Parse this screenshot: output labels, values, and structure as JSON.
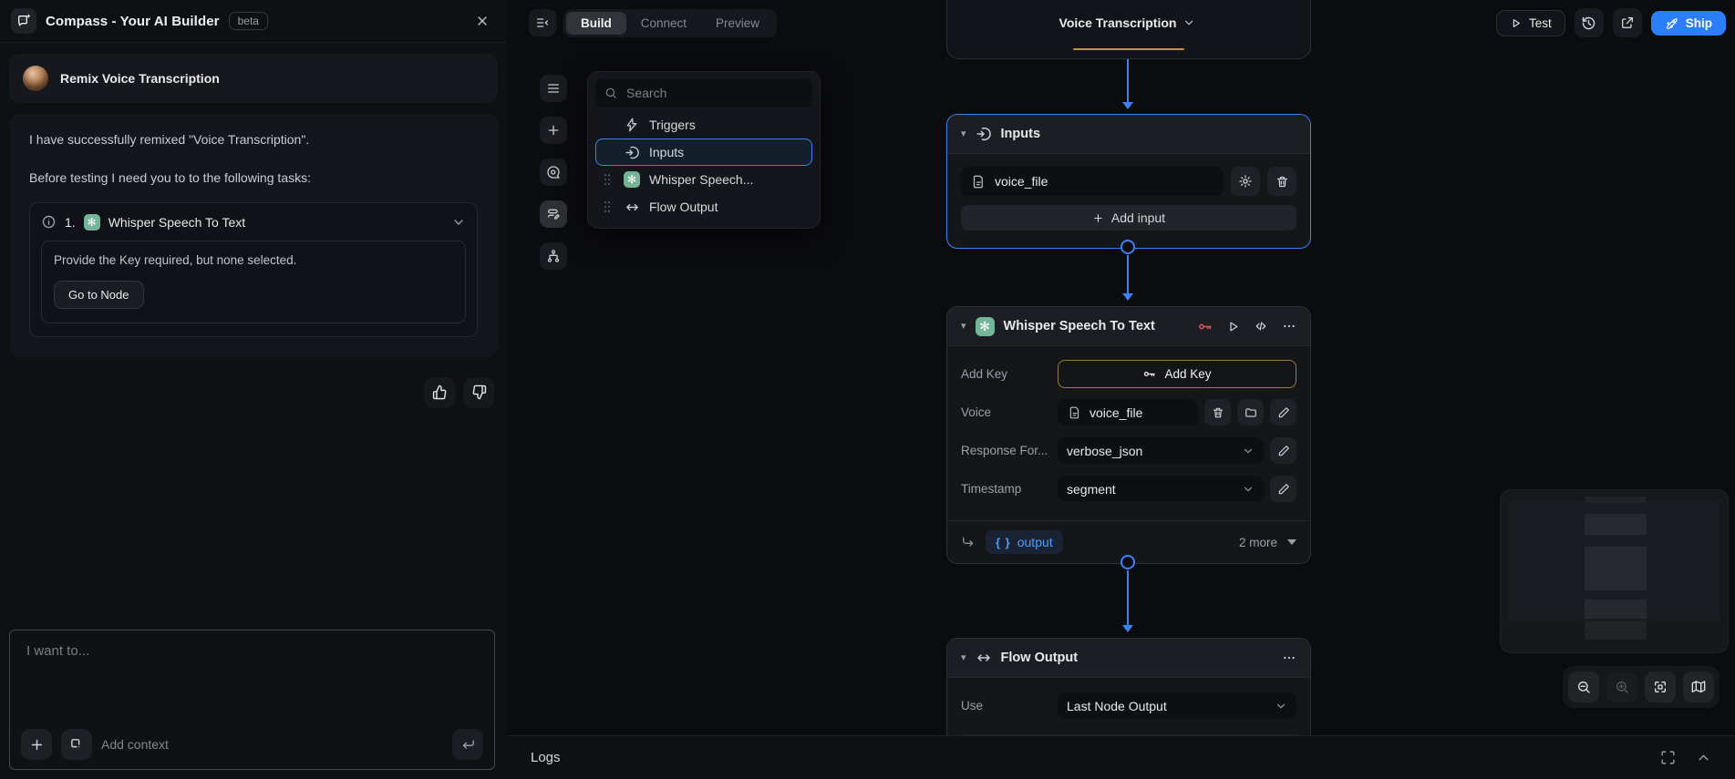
{
  "colors": {
    "accent_blue": "#3b82f6",
    "ship_blue": "#2b7fff",
    "openai_teal": "#74b598",
    "key_red": "#e5565f",
    "warn_gold": "#c29245"
  },
  "icons": {
    "caret_down": "▾",
    "openai_glyph": "✻",
    "braces": "{ }",
    "gear": "⚙"
  },
  "titlebar": {
    "app_title": "Compass - Your AI Builder",
    "beta_badge": "beta"
  },
  "chat": {
    "thread_title": "Remix Voice Transcription",
    "message": {
      "line1": "I have successfully remixed \"Voice Transcription\".",
      "line2": "Before testing I need you to to the following tasks:",
      "task": {
        "index": "1.",
        "title": "Whisper Speech To Text",
        "description": "Provide the Key required, but none selected.",
        "action_label": "Go to Node"
      }
    },
    "composer": {
      "placeholder": "I want to...",
      "add_context_label": "Add context"
    }
  },
  "topbar": {
    "tabs": [
      {
        "label": "Build"
      },
      {
        "label": "Connect"
      },
      {
        "label": "Preview"
      }
    ],
    "flow_title": "Voice Transcription",
    "test_label": "Test",
    "ship_label": "Ship"
  },
  "palette": {
    "search_placeholder": "Search",
    "items": [
      {
        "label": "Triggers"
      },
      {
        "label": "Inputs"
      },
      {
        "label": "Whisper Speech..."
      },
      {
        "label": "Flow Output"
      }
    ]
  },
  "flow": {
    "inputs_node": {
      "title": "Inputs",
      "field_value": "voice_file",
      "add_input_label": "Add input"
    },
    "whisper_node": {
      "title": "Whisper Speech To Text",
      "rows": [
        {
          "label": "Add Key",
          "value": "Add Key"
        },
        {
          "label": "Voice",
          "value": "voice_file"
        },
        {
          "label": "Response For...",
          "value": "verbose_json"
        },
        {
          "label": "Timestamp",
          "value": "segment"
        }
      ],
      "output_chip": "output",
      "more_label": "2 more"
    },
    "flow_output_node": {
      "title": "Flow Output",
      "use_label": "Use",
      "use_value": "Last Node Output"
    }
  },
  "logs": {
    "title": "Logs"
  }
}
